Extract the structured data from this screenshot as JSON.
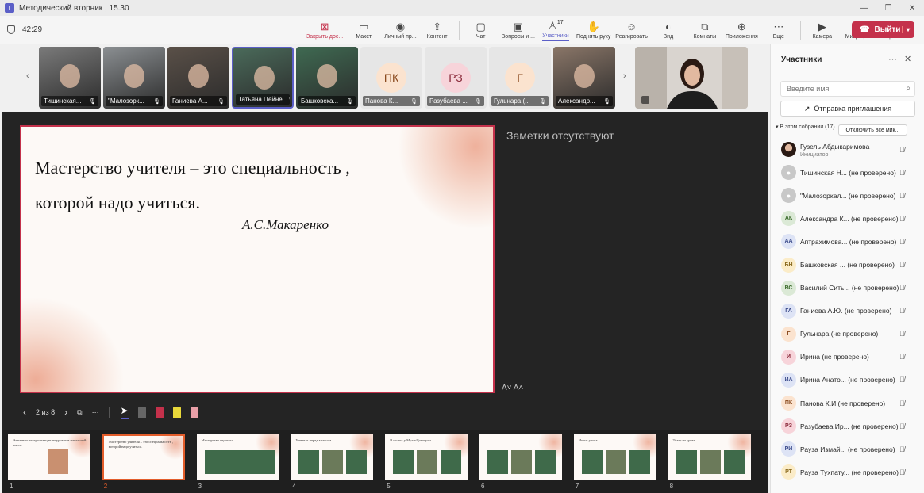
{
  "window": {
    "title": "Методический вторник , 15.30",
    "controls": [
      "—",
      "❐",
      "✕"
    ]
  },
  "toolbar": {
    "timer": "42:29",
    "items": [
      {
        "label": "Закрыть дос...",
        "icon": "stop-share-icon",
        "glyph": "⊠",
        "red": true
      },
      {
        "label": "Макет",
        "icon": "layout-icon",
        "glyph": "▭"
      },
      {
        "label": "Личный пр...",
        "icon": "private-view-icon",
        "glyph": "◉"
      },
      {
        "label": "Контент",
        "icon": "content-icon",
        "glyph": "⇪"
      },
      {
        "label": "Чат",
        "icon": "chat-icon",
        "glyph": "▢"
      },
      {
        "label": "Вопросы и ...",
        "icon": "qa-icon",
        "glyph": "▣"
      },
      {
        "label": "Участники",
        "icon": "participants-icon",
        "glyph": "♙",
        "count": "17",
        "active": true
      },
      {
        "label": "Поднять руку",
        "icon": "raise-hand-icon",
        "glyph": "✋"
      },
      {
        "label": "Реагировать",
        "icon": "react-icon",
        "glyph": "☺"
      },
      {
        "label": "Вид",
        "icon": "view-icon",
        "glyph": "◐"
      },
      {
        "label": "Комнаты",
        "icon": "rooms-icon",
        "glyph": "⧉"
      },
      {
        "label": "Приложения",
        "icon": "apps-icon",
        "glyph": "⊕"
      },
      {
        "label": "Еще",
        "icon": "more-icon",
        "glyph": "⋯"
      }
    ],
    "devices": [
      {
        "label": "Камера",
        "icon": "camera-icon",
        "glyph": "▶"
      },
      {
        "label": "Микрофон",
        "icon": "mic-off-icon",
        "glyph": "🎙"
      },
      {
        "label": "Поделиться",
        "icon": "share-icon",
        "glyph": "⬆"
      }
    ],
    "leave_label": "Выйти"
  },
  "strip": {
    "tiles": [
      {
        "name": "Тишинская...",
        "kind": "photo",
        "color": "#7a7a7a"
      },
      {
        "name": "\"Малозорк...",
        "kind": "photo",
        "color": "#8b8f92"
      },
      {
        "name": "Ганиева А...",
        "kind": "photo",
        "color": "#5a5048"
      },
      {
        "name": "Татьяна Цейне...",
        "kind": "photo",
        "color": "#4a6a5a",
        "selected": true
      },
      {
        "name": "Башковска...",
        "kind": "photo",
        "color": "#3f6a52"
      },
      {
        "name": "Панова К...",
        "kind": "initials",
        "initials": "ПК",
        "bg": "#fbe3cf",
        "fg": "#8a4a1e"
      },
      {
        "name": "Разубаева ...",
        "kind": "initials",
        "initials": "РЗ",
        "bg": "#f7d4da",
        "fg": "#8a2a3a"
      },
      {
        "name": "Гульнара (...",
        "kind": "initials",
        "initials": "Г",
        "bg": "#fbe3cf",
        "fg": "#8a4a1e"
      },
      {
        "name": "Александр...",
        "kind": "photo",
        "color": "#8a7668"
      }
    ]
  },
  "slide": {
    "quote_line1": "Мастерство учителя – это специальность ,",
    "quote_line2": "которой надо учиться.",
    "author": "А.С.Макаренко",
    "notes": "Заметки отсутствуют",
    "page": "2 из 8",
    "font_ctl": "A˅  A˄"
  },
  "thumbnails": [
    {
      "num": "1",
      "text": "Элементы театрализации на уроках в начальной школе"
    },
    {
      "num": "2",
      "text": "Мастерство учителя – это специальность , которой надо учиться.",
      "current": true
    },
    {
      "num": "3",
      "text": "Мастерство педагога"
    },
    {
      "num": "4",
      "text": "Учитель перед классом"
    },
    {
      "num": "5",
      "text": "В гостях у Мухи-Цокотухи"
    },
    {
      "num": "6",
      "text": ""
    },
    {
      "num": "7",
      "text": "Итоги урока"
    },
    {
      "num": "8",
      "text": "Театр на уроке"
    }
  ],
  "panel": {
    "title": "Участники",
    "search_placeholder": "Введите имя",
    "invite_label": "Отправка приглашения",
    "meeting_label": "В этом собрании (17)",
    "mute_all_label": "Отключить все мик...",
    "participants": [
      {
        "name": "Гузель Абдыкаримова",
        "role": "Инициатор",
        "avatar": "photo",
        "bg": "#5a3a2a",
        "fg": "#fff",
        "initials": ""
      },
      {
        "name": "Тишинская Н... (не проверено)",
        "avatar": "generic",
        "bg": "#c8c8c8",
        "fg": "#fff",
        "initials": ""
      },
      {
        "name": "\"Малозоркал... (не проверено)",
        "avatar": "generic",
        "bg": "#c8c8c8",
        "fg": "#fff",
        "initials": ""
      },
      {
        "name": "Александра К... (не проверено)",
        "initials": "АК",
        "bg": "#dbe9d6",
        "fg": "#3a6a2a"
      },
      {
        "name": "Аптрахимова... (не проверено)",
        "initials": "АА",
        "bg": "#dde3f5",
        "fg": "#3a4a8a"
      },
      {
        "name": "Башковская ... (не проверено)",
        "initials": "БН",
        "bg": "#fbecc8",
        "fg": "#8a6a1e"
      },
      {
        "name": "Василий Сить... (не проверено)",
        "initials": "ВС",
        "bg": "#dbe9d6",
        "fg": "#3a6a2a"
      },
      {
        "name": "Ганиева А.Ю. (не проверено)",
        "initials": "ГА",
        "bg": "#dde3f5",
        "fg": "#3a4a8a"
      },
      {
        "name": "Гульнара (не проверено)",
        "initials": "Г",
        "bg": "#fbe3cf",
        "fg": "#8a4a1e"
      },
      {
        "name": "Ирина (не проверено)",
        "initials": "И",
        "bg": "#f7d4da",
        "fg": "#8a2a3a"
      },
      {
        "name": "Ирина Анато... (не проверено)",
        "initials": "ИА",
        "bg": "#dde3f5",
        "fg": "#3a4a8a"
      },
      {
        "name": "Панова К.И (не проверено)",
        "initials": "ПК",
        "bg": "#fbe3cf",
        "fg": "#8a4a1e"
      },
      {
        "name": "Разубаева Ир... (не проверено)",
        "initials": "РЗ",
        "bg": "#f7d4da",
        "fg": "#8a2a3a"
      },
      {
        "name": "Рауза Измай... (не проверено)",
        "initials": "РИ",
        "bg": "#dde3f5",
        "fg": "#3a4a8a"
      },
      {
        "name": "Рауза Тухпату... (не проверено)",
        "initials": "РТ",
        "bg": "#fbecc8",
        "fg": "#8a6a1e"
      }
    ]
  }
}
